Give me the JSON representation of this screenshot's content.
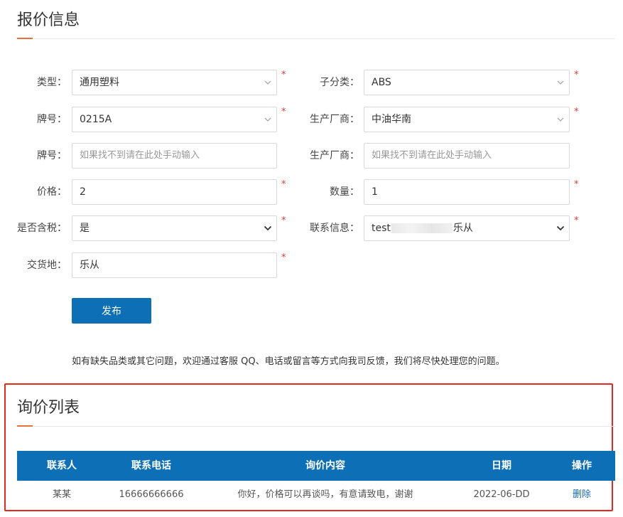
{
  "quote_section": {
    "title": "报价信息"
  },
  "form": {
    "type": {
      "label": "类型：",
      "value": "通用塑料"
    },
    "subcategory": {
      "label": "子分类：",
      "value": "ABS"
    },
    "grade": {
      "label": "牌号：",
      "value": "0215A"
    },
    "manufacturer": {
      "label": "生产厂商：",
      "value": "中油华南"
    },
    "grade_manual": {
      "label": "牌号：",
      "placeholder": "如果找不到请在此处手动输入"
    },
    "manufacturer_manual": {
      "label": "生产厂商：",
      "placeholder": "如果找不到请在此处手动输入"
    },
    "price": {
      "label": "价格：",
      "value": "2"
    },
    "quantity": {
      "label": "数量：",
      "value": "1"
    },
    "tax_included": {
      "label": "是否含税：",
      "value": "是"
    },
    "contact_info": {
      "label": "联系信息：",
      "value_prefix": "test",
      "value_suffix": "乐从"
    },
    "delivery_place": {
      "label": "交货地：",
      "value": "乐从"
    },
    "required_mark": "*",
    "publish_label": "发布"
  },
  "notice": "如有缺失品类或其它问题，欢迎通过客服 QQ、电话或留言等方式向我司反馈，我们将尽快处理您的问题。",
  "inquiry_section": {
    "title": "询价列表"
  },
  "table": {
    "headers": [
      "联系人",
      "联系电话",
      "询价内容",
      "日期",
      "操作"
    ],
    "rows": [
      {
        "contact": "某某",
        "phone": "16666666666",
        "content": "你好，价格可以再谈吗，有意请致电，谢谢",
        "date": "2022-06-DD",
        "action": "删除"
      }
    ]
  },
  "colors": {
    "accent": "#0d6fb5",
    "title_underline": "#e8703a",
    "required": "#e53935",
    "highlight_box": "#e8281f"
  }
}
